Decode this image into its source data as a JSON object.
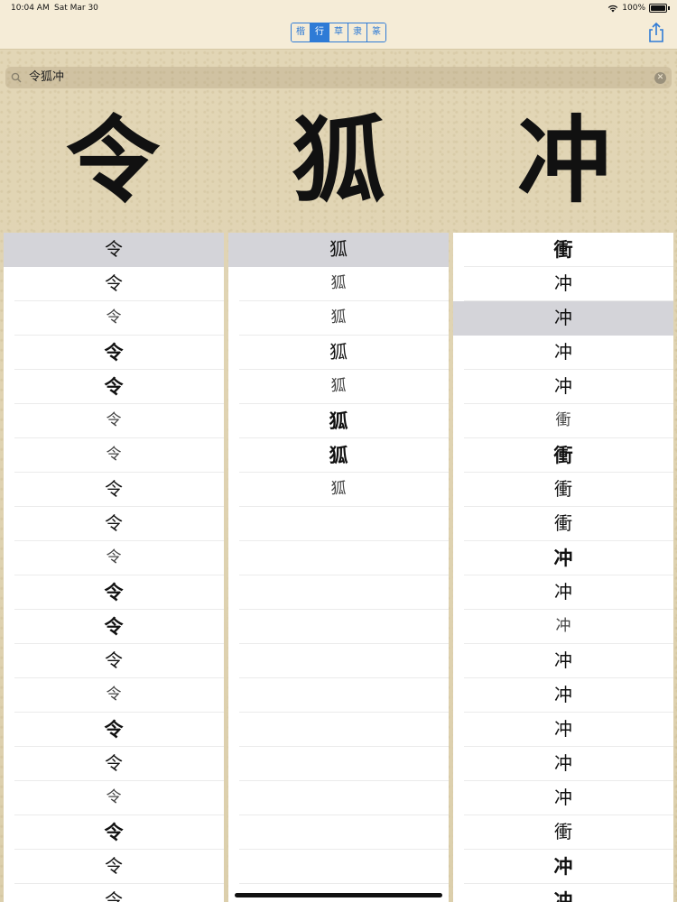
{
  "status": {
    "time": "10:04 AM",
    "date": "Sat Mar 30",
    "battery": "100%"
  },
  "style_tabs": [
    {
      "label": "楷",
      "active": false
    },
    {
      "label": "行",
      "active": true
    },
    {
      "label": "草",
      "active": false
    },
    {
      "label": "隶",
      "active": false
    },
    {
      "label": "篆",
      "active": false
    }
  ],
  "search": {
    "value": "令狐冲"
  },
  "big_chars": [
    "令",
    "狐",
    "冲"
  ],
  "columns": [
    {
      "selected_index": 0,
      "rows": [
        "令",
        "令",
        "令",
        "令",
        "令",
        "令",
        "令",
        "令",
        "令",
        "令",
        "令",
        "令",
        "令",
        "令",
        "令",
        "令",
        "令",
        "令",
        "令",
        "令"
      ],
      "weights": [
        "n",
        "n",
        "l",
        "b",
        "b",
        "l",
        "l",
        "n",
        "n",
        "l",
        "b",
        "b",
        "n",
        "l",
        "b",
        "n",
        "l",
        "b",
        "n",
        "n"
      ]
    },
    {
      "selected_index": 0,
      "rows": [
        "狐",
        "狐",
        "狐",
        "狐",
        "狐",
        "狐",
        "狐",
        "狐",
        "",
        "",
        "",
        "",
        "",
        "",
        "",
        "",
        "",
        "",
        "",
        ""
      ],
      "weights": [
        "n",
        "l",
        "l",
        "n",
        "l",
        "b",
        "b",
        "l",
        "n",
        "n",
        "n",
        "n",
        "n",
        "n",
        "n",
        "n",
        "n",
        "n",
        "n",
        "n"
      ]
    },
    {
      "selected_index": 2,
      "rows": [
        "衝",
        "冲",
        "冲",
        "冲",
        "冲",
        "衝",
        "衝",
        "衝",
        "衝",
        "冲",
        "冲",
        "冲",
        "冲",
        "冲",
        "冲",
        "冲",
        "冲",
        "衝",
        "冲",
        "冲"
      ],
      "weights": [
        "b",
        "n",
        "n",
        "n",
        "n",
        "l",
        "b",
        "n",
        "n",
        "b",
        "n",
        "l",
        "n",
        "n",
        "n",
        "n",
        "n",
        "n",
        "b",
        "b"
      ]
    }
  ],
  "colors": {
    "accent": "#2f7bd6",
    "selected_row": "#d4d4d9",
    "paper": "#dfd3b2"
  }
}
